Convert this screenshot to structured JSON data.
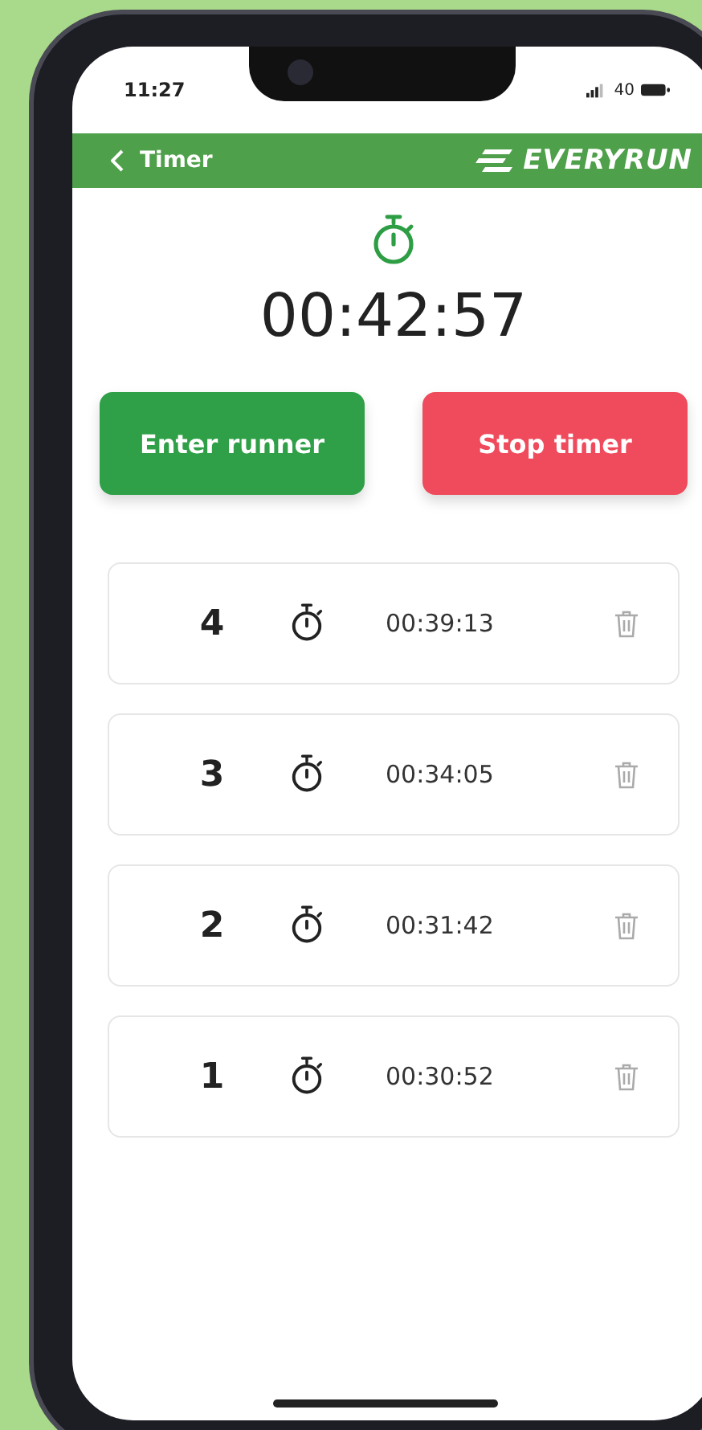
{
  "status_bar": {
    "time": "11:27",
    "battery": "40"
  },
  "header": {
    "back_label": "Timer",
    "brand": "EVERYRUN"
  },
  "timer": {
    "elapsed": "00:42:57"
  },
  "buttons": [
    {
      "label": "Enter runner",
      "kind": "primary"
    },
    {
      "label": "Stop timer",
      "kind": "danger"
    }
  ],
  "laps": [
    {
      "runner": "4",
      "time": "00:39:13"
    },
    {
      "runner": "3",
      "time": "00:34:05"
    },
    {
      "runner": "2",
      "time": "00:31:42"
    },
    {
      "runner": "1",
      "time": "00:30:52"
    }
  ]
}
